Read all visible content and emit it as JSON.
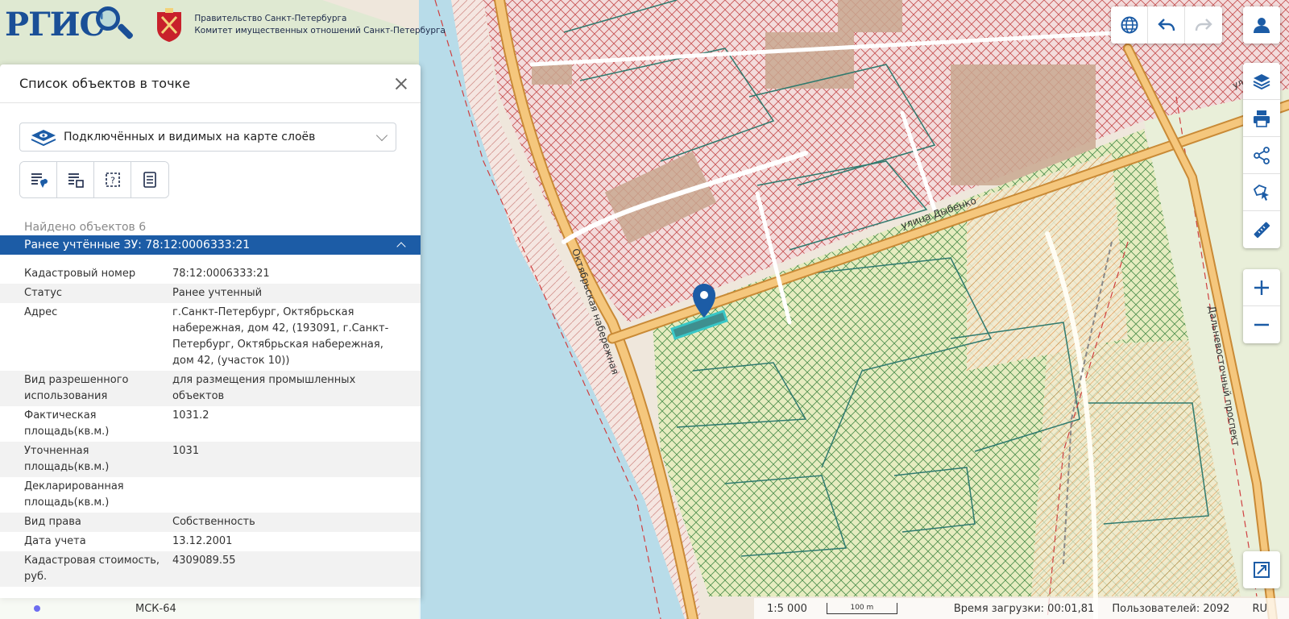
{
  "header": {
    "logo_text": "РГИС",
    "org_line1": "Правительство Санкт-Петербурга",
    "org_line2": "Комитет имущественных отношений Санкт-Петербурга"
  },
  "map": {
    "street_1": "улица Дыбенко",
    "street_2": "Октябрьская набережная",
    "street_3": "Дальневосточный проспект",
    "street_4": "ул."
  },
  "panel": {
    "title": "Список объектов в точке",
    "layer_select": "Подключённых и видимых на карте слоёв",
    "found": "Найдено объектов 6",
    "section": "Ранее учтённые ЗУ: 78:12:0006333:21",
    "props": [
      {
        "k": "Кадастровый номер",
        "v": "78:12:0006333:21"
      },
      {
        "k": "Статус",
        "v": "Ранее учтенный"
      },
      {
        "k": "Адрес",
        "v": "г.Санкт-Петербург, Октябрьская набережная, дом 42, (193091, г.Санкт-Петербург, Октябрьская набережная, дом 42, (участок 10))"
      },
      {
        "k": "Вид разрешенного использования",
        "v": "для размещения промышленных объектов"
      },
      {
        "k": "Фактическая площадь(кв.м.)",
        "v": "1031.2"
      },
      {
        "k": "Уточненная площадь(кв.м.)",
        "v": "1031"
      },
      {
        "k": "Декларированная площадь(кв.м.)",
        "v": ""
      },
      {
        "k": "Вид права",
        "v": "Собственность"
      },
      {
        "k": "Дата учета",
        "v": "13.12.2001"
      },
      {
        "k": "Кадастровая стоимость, руб.",
        "v": "4309089.55"
      }
    ]
  },
  "status": {
    "crs": "МСК-64",
    "scale": "1:5 000",
    "scalebar": "100 m",
    "loadtime": "Время загрузки: 00:01,81",
    "users": "Пользователей: 2092",
    "lang": "RU"
  },
  "colors": {
    "accent": "#1c5ca6",
    "water": "#b8dce9",
    "road": "#f5b85c"
  }
}
